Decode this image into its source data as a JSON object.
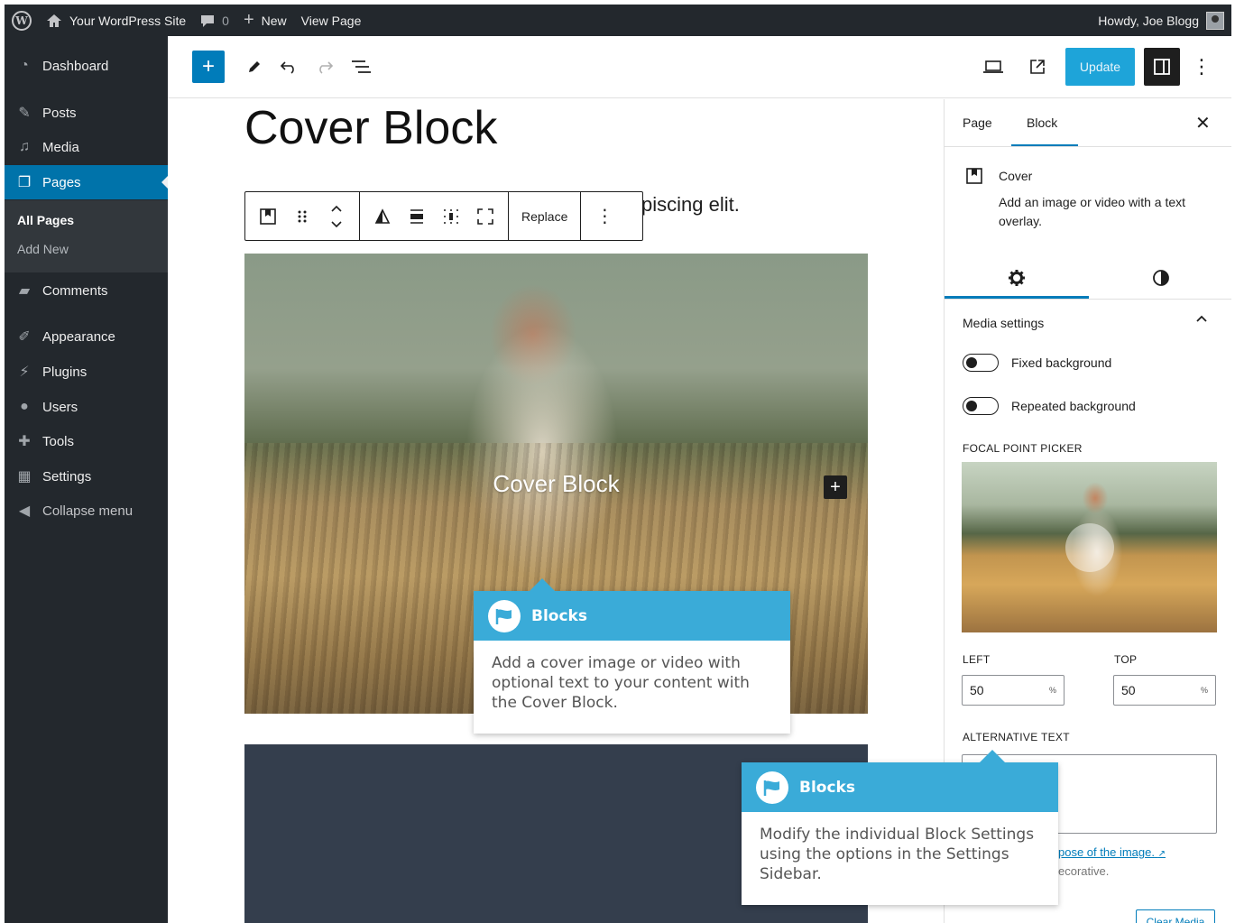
{
  "admin_bar": {
    "site_name": "Your WordPress Site",
    "comments_count": "0",
    "new_label": "New",
    "view_page_label": "View Page",
    "howdy": "Howdy, Joe Blogg"
  },
  "sidebar": {
    "items": [
      {
        "label": "Dashboard",
        "icon": "dashboard-icon"
      },
      {
        "label": "Posts",
        "icon": "pin-icon"
      },
      {
        "label": "Media",
        "icon": "media-icon"
      },
      {
        "label": "Pages",
        "icon": "pages-icon"
      },
      {
        "label": "Comments",
        "icon": "comment-icon"
      },
      {
        "label": "Appearance",
        "icon": "brush-icon"
      },
      {
        "label": "Plugins",
        "icon": "plugin-icon"
      },
      {
        "label": "Users",
        "icon": "users-icon"
      },
      {
        "label": "Tools",
        "icon": "wrench-icon"
      },
      {
        "label": "Settings",
        "icon": "settings-icon"
      },
      {
        "label": "Collapse menu",
        "icon": "collapse-icon"
      }
    ],
    "submenu": [
      "All Pages",
      "Add New"
    ]
  },
  "toolbar": {
    "update_label": "Update"
  },
  "editor": {
    "title": "Cover Block",
    "paragraph_visible": "piscing elit.",
    "block_toolbar": {
      "replace_label": "Replace"
    },
    "cover_title": "Cover Block"
  },
  "tooltip_cover": {
    "heading": "Blocks",
    "body": "Add a cover image or video with optional text to your content with the Cover Block."
  },
  "tooltip_settings": {
    "heading": "Blocks",
    "body": "Modify the individual Block Settings using the options in the Settings Sidebar."
  },
  "settings": {
    "tabs": [
      "Page",
      "Block"
    ],
    "block_name": "Cover",
    "block_description": "Add an image or video with a text overlay.",
    "media_settings_title": "Media settings",
    "fixed_background": "Fixed background",
    "repeated_background": "Repeated background",
    "focal_point_label": "FOCAL POINT PICKER",
    "left_label": "LEFT",
    "top_label": "TOP",
    "left_value": "50",
    "top_value": "50",
    "unit": "%",
    "alt_text_label": "ALTERNATIVE TEXT",
    "alt_help_link": "pose of the image.",
    "alt_help_tail": "ecorative.",
    "clear_media_label": "Clear Media"
  },
  "colors": {
    "wp_blue": "#007cba",
    "admin_dark": "#23282d",
    "tooltip_blue": "#3aabd8"
  }
}
